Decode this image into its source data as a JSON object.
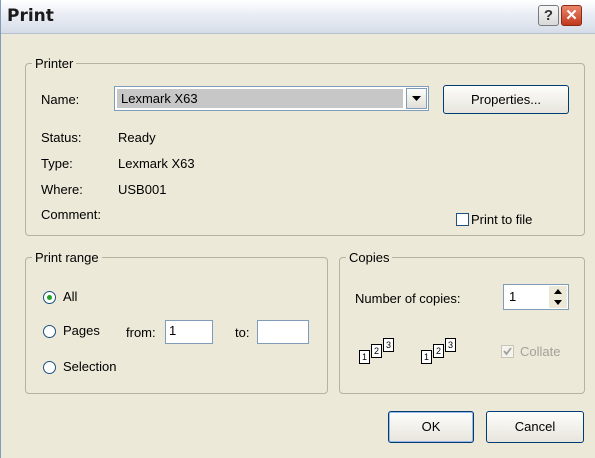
{
  "window": {
    "title": "Print",
    "help_glyph": "?",
    "close_glyph": "✕"
  },
  "printer": {
    "legend": "Printer",
    "name_label": "Name:",
    "name_value": "Lexmark X63",
    "properties_label": "Properties...",
    "status_label": "Status:",
    "status_value": "Ready",
    "type_label": "Type:",
    "type_value": "Lexmark X63",
    "where_label": "Where:",
    "where_value": "USB001",
    "comment_label": "Comment:",
    "comment_value": "",
    "print_to_file_label": "Print to file",
    "print_to_file_checked": false
  },
  "print_range": {
    "legend": "Print range",
    "all_label": "All",
    "pages_label": "Pages",
    "from_label": "from:",
    "from_value": "1",
    "to_label": "to:",
    "to_value": "",
    "selection_label": "Selection",
    "selected": "All"
  },
  "copies": {
    "legend": "Copies",
    "number_label": "Number of copies:",
    "number_value": "1",
    "collate_label": "Collate",
    "collate_checked": true,
    "collate_enabled": false,
    "stack_pages": [
      "1",
      "2",
      "3"
    ]
  },
  "buttons": {
    "ok": "OK",
    "cancel": "Cancel"
  },
  "colors": {
    "face": "#ece9d8",
    "title_gradient_top": "#ffffff",
    "close_red": "#c1391d",
    "radio_dot": "#21a121"
  }
}
